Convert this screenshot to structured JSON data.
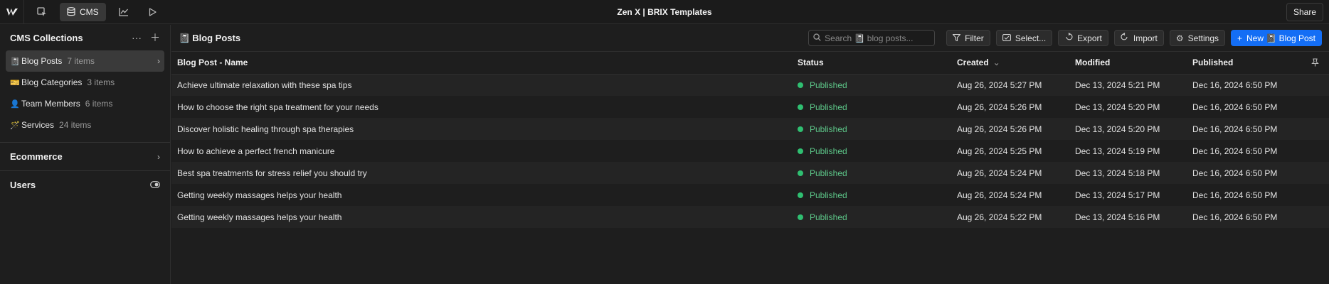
{
  "topbar": {
    "title": "Zen X | BRIX Templates",
    "cms_label": "CMS",
    "share_label": "Share"
  },
  "sidebar": {
    "heading": "CMS Collections",
    "collections": [
      {
        "emoji": "📓",
        "name": "Blog Posts",
        "count": "7 items"
      },
      {
        "emoji": "🎫",
        "name": "Blog Categories",
        "count": "3 items"
      },
      {
        "emoji": "👤",
        "name": "Team Members",
        "count": "6 items"
      },
      {
        "emoji": "🪄",
        "name": "Services",
        "count": "24 items"
      }
    ],
    "ecommerce": "Ecommerce",
    "users": "Users"
  },
  "main": {
    "emoji": "📓",
    "title": "Blog Posts",
    "search_placeholder": "Search 📓 blog posts...",
    "buttons": {
      "filter": "Filter",
      "select": "Select...",
      "export": "Export",
      "import": "Import",
      "settings": "Settings",
      "new": "New 📓 Blog Post"
    },
    "columns": [
      "Blog Post - Name",
      "Status",
      "Created",
      "Modified",
      "Published"
    ],
    "rows": [
      {
        "name": "Achieve ultimate relaxation with these spa tips",
        "status": "Published",
        "created": "Aug 26, 2024 5:27 PM",
        "modified": "Dec 13, 2024 5:21 PM",
        "published": "Dec 16, 2024 6:50 PM"
      },
      {
        "name": "How to choose the right spa treatment for your needs",
        "status": "Published",
        "created": "Aug 26, 2024 5:26 PM",
        "modified": "Dec 13, 2024 5:20 PM",
        "published": "Dec 16, 2024 6:50 PM"
      },
      {
        "name": "Discover holistic healing through spa therapies",
        "status": "Published",
        "created": "Aug 26, 2024 5:26 PM",
        "modified": "Dec 13, 2024 5:20 PM",
        "published": "Dec 16, 2024 6:50 PM"
      },
      {
        "name": "How to achieve a perfect french manicure",
        "status": "Published",
        "created": "Aug 26, 2024 5:25 PM",
        "modified": "Dec 13, 2024 5:19 PM",
        "published": "Dec 16, 2024 6:50 PM"
      },
      {
        "name": "Best spa treatments for stress relief you should try",
        "status": "Published",
        "created": "Aug 26, 2024 5:24 PM",
        "modified": "Dec 13, 2024 5:18 PM",
        "published": "Dec 16, 2024 6:50 PM"
      },
      {
        "name": "Getting weekly massages helps your health",
        "status": "Published",
        "created": "Aug 26, 2024 5:24 PM",
        "modified": "Dec 13, 2024 5:17 PM",
        "published": "Dec 16, 2024 6:50 PM"
      },
      {
        "name": "Getting weekly massages helps your health",
        "status": "Published",
        "created": "Aug 26, 2024 5:22 PM",
        "modified": "Dec 13, 2024 5:16 PM",
        "published": "Dec 16, 2024 6:50 PM"
      }
    ]
  },
  "colors": {
    "accent": "#146ef5",
    "published": "#2fbf71",
    "background": "#1e1e1e"
  },
  "icons": [
    "webflow-logo-icon",
    "cursor-select-icon",
    "database-icon",
    "chart-icon",
    "play-icon",
    "more-icon",
    "plus-icon",
    "chevron-right-icon",
    "eye-toggle-icon",
    "search-icon",
    "filter-icon",
    "select-icon",
    "export-icon",
    "import-icon",
    "gear-icon",
    "pin-icon",
    "sort-down-icon"
  ]
}
